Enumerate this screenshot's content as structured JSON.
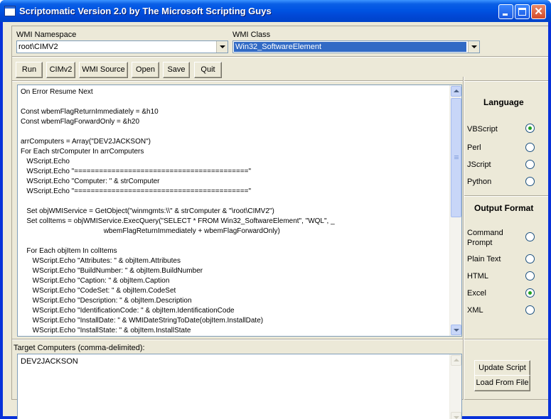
{
  "window": {
    "title": "Scriptomatic Version 2.0 by The Microsoft Scripting Guys",
    "titlebar_color": "#0054e3"
  },
  "namespace": {
    "label": "WMI Namespace",
    "value": "root\\CIMV2"
  },
  "wmi_class": {
    "label": "WMI Class",
    "value": "Win32_SoftwareElement",
    "selection_color": "#316ac5"
  },
  "toolbar": {
    "run": "Run",
    "cimv2": "CIMv2",
    "wmi_source": "WMI Source",
    "open": "Open",
    "save": "Save",
    "quit": "Quit"
  },
  "script": {
    "lines": [
      "On Error Resume Next",
      "",
      "Const wbemFlagReturnImmediately = &h10",
      "Const wbemFlagForwardOnly = &h20",
      "",
      "arrComputers = Array(\"DEV2JACKSON\")",
      "For Each strComputer In arrComputers",
      "   WScript.Echo",
      "   WScript.Echo \"==========================================\"",
      "   WScript.Echo \"Computer: \" & strComputer",
      "   WScript.Echo \"==========================================\"",
      "",
      "   Set objWMIService = GetObject(\"winmgmts:\\\\\" & strComputer & \"\\root\\CIMV2\")",
      "   Set colItems = objWMIService.ExecQuery(\"SELECT * FROM Win32_SoftwareElement\", \"WQL\", _",
      "                                          wbemFlagReturnImmediately + wbemFlagForwardOnly)",
      "",
      "   For Each objItem In colItems",
      "      WScript.Echo \"Attributes: \" & objItem.Attributes",
      "      WScript.Echo \"BuildNumber: \" & objItem.BuildNumber",
      "      WScript.Echo \"Caption: \" & objItem.Caption",
      "      WScript.Echo \"CodeSet: \" & objItem.CodeSet",
      "      WScript.Echo \"Description: \" & objItem.Description",
      "      WScript.Echo \"IdentificationCode: \" & objItem.IdentificationCode",
      "      WScript.Echo \"InstallDate: \" & WMIDateStringToDate(objItem.InstallDate)",
      "      WScript.Echo \"InstallState: \" & objItem.InstallState"
    ]
  },
  "target": {
    "label": "Target Computers (comma-delimited):",
    "value": "DEV2JACKSON"
  },
  "language": {
    "heading": "Language",
    "options": [
      {
        "label": "VBScript",
        "selected": true
      },
      {
        "label": "Perl",
        "selected": false
      },
      {
        "label": "JScript",
        "selected": false
      },
      {
        "label": "Python",
        "selected": false
      }
    ]
  },
  "output_format": {
    "heading": "Output Format",
    "options": [
      {
        "label": "Command Prompt",
        "selected": false
      },
      {
        "label": "Plain Text",
        "selected": false
      },
      {
        "label": "HTML",
        "selected": false
      },
      {
        "label": "Excel",
        "selected": true
      },
      {
        "label": "XML",
        "selected": false
      }
    ]
  },
  "actions": {
    "update_script": "Update Script",
    "load_from_file": "Load From File"
  }
}
